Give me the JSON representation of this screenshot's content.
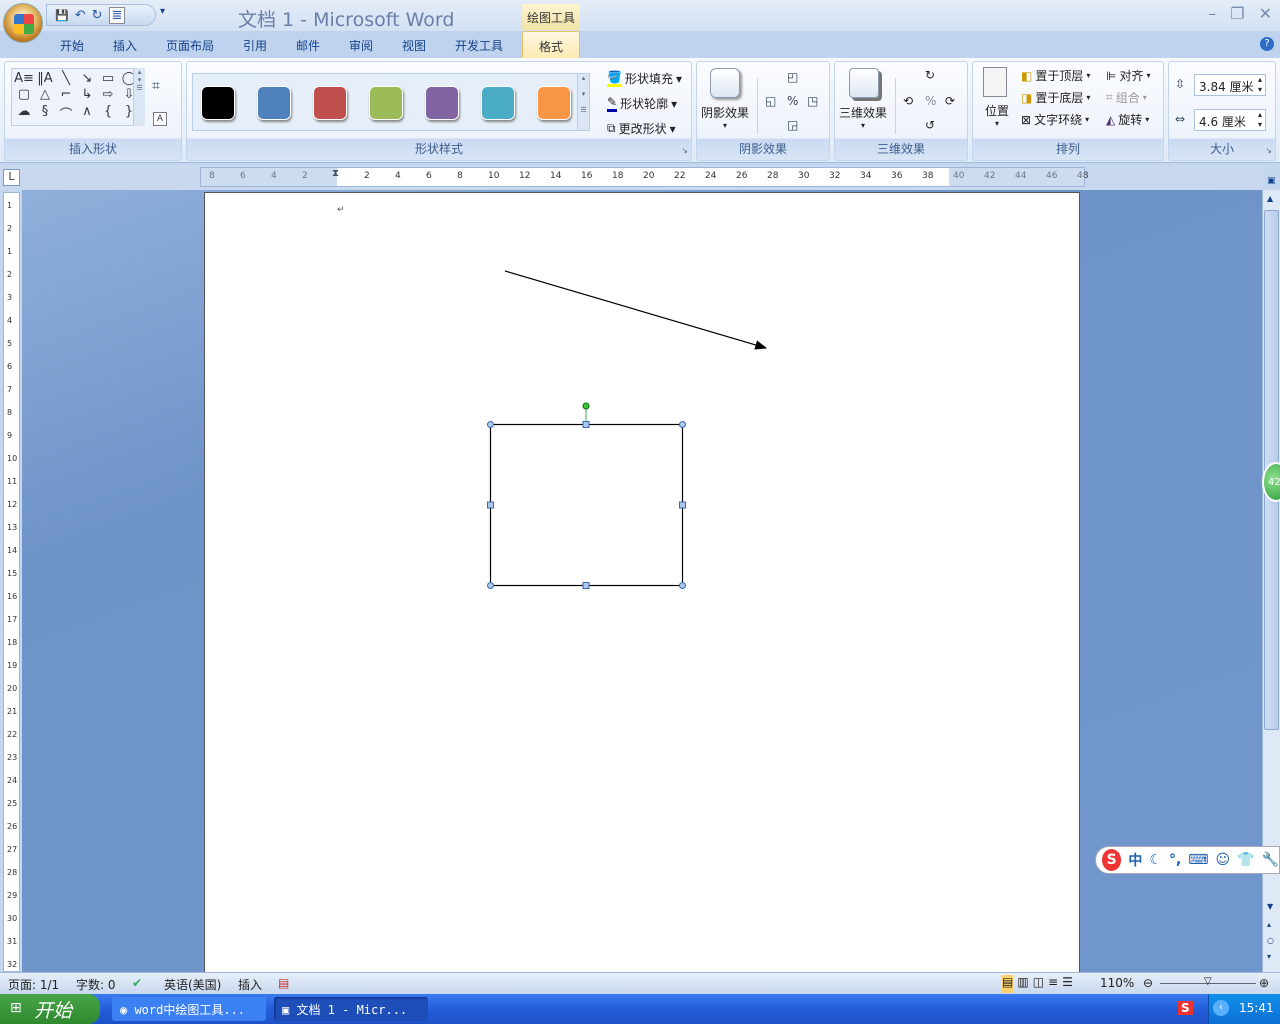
{
  "window": {
    "title": "文档 1 - Microsoft Word",
    "context_tab": "绘图工具",
    "minimize": "–",
    "restore": "❐",
    "close": "✕"
  },
  "qat": {
    "save": "💾",
    "undo": "↶",
    "redo": "↻",
    "format": "≣",
    "more": "▾"
  },
  "tabs": [
    {
      "label": "开始"
    },
    {
      "label": "插入"
    },
    {
      "label": "页面布局"
    },
    {
      "label": "引用"
    },
    {
      "label": "邮件"
    },
    {
      "label": "审阅"
    },
    {
      "label": "视图"
    },
    {
      "label": "开发工具"
    },
    {
      "label": "格式"
    }
  ],
  "help": "?",
  "ribbon": {
    "insert_shapes": {
      "label": "插入形状",
      "shapes": [
        "A≡",
        "‖A",
        "╲",
        "↘",
        "▭",
        "◯",
        "▢",
        "△",
        "⌐",
        "↳",
        "⇨",
        "⇩",
        "☁",
        "§",
        "⌒",
        "∧",
        "{",
        "}"
      ]
    },
    "shape_styles": {
      "label": "形状样式",
      "swatches": [
        "#000000",
        "#4f81bd",
        "#c0504d",
        "#9bbb59",
        "#8064a2",
        "#4bacc6",
        "#f79646"
      ],
      "fill": "形状填充",
      "outline": "形状轮廓",
      "change": "更改形状"
    },
    "shadow": {
      "label": "阴影效果",
      "button": "阴影效果"
    },
    "threed": {
      "label": "三维效果",
      "button": "三维效果"
    },
    "arrange": {
      "label": "排列",
      "position": "位置",
      "bring_front": "置于顶层",
      "send_back": "置于底层",
      "text_wrap": "文字环绕",
      "align": "对齐",
      "group": "组合",
      "rotate": "旋转"
    },
    "size": {
      "label": "大小",
      "height": "3.84 厘米",
      "width": "4.6 厘米"
    }
  },
  "ruler": {
    "h_labels": [
      "8",
      "6",
      "4",
      "2",
      "",
      "2",
      "4",
      "6",
      "8",
      "10",
      "12",
      "14",
      "16",
      "18",
      "20",
      "22",
      "24",
      "26",
      "28",
      "30",
      "32",
      "34",
      "36",
      "38",
      "40",
      "42",
      "44",
      "46",
      "48"
    ],
    "v_labels": [
      "1",
      "2",
      "1",
      "2",
      "3",
      "4",
      "5",
      "6",
      "7",
      "8",
      "9",
      "10",
      "11",
      "12",
      "13",
      "14",
      "15",
      "16",
      "17",
      "18",
      "19",
      "20",
      "21",
      "22",
      "23",
      "24",
      "25",
      "26",
      "27",
      "28",
      "29",
      "30",
      "31",
      "32",
      "33"
    ]
  },
  "document": {
    "paragraph_mark": "↵"
  },
  "status": {
    "page": "页面: 1/1",
    "words": "字数: 0",
    "language": "英语(美国)",
    "mode": "插入",
    "zoom": "110%"
  },
  "ime": {
    "mode": "中",
    "icons": [
      "☾",
      "°,",
      "⌨",
      "☺",
      "👕",
      "🔧"
    ]
  },
  "side_badge": "42",
  "taskbar": {
    "start": "开始",
    "tasks": [
      "word中绘图工具...",
      "文档 1 - Micr..."
    ],
    "clock": "15:41"
  }
}
